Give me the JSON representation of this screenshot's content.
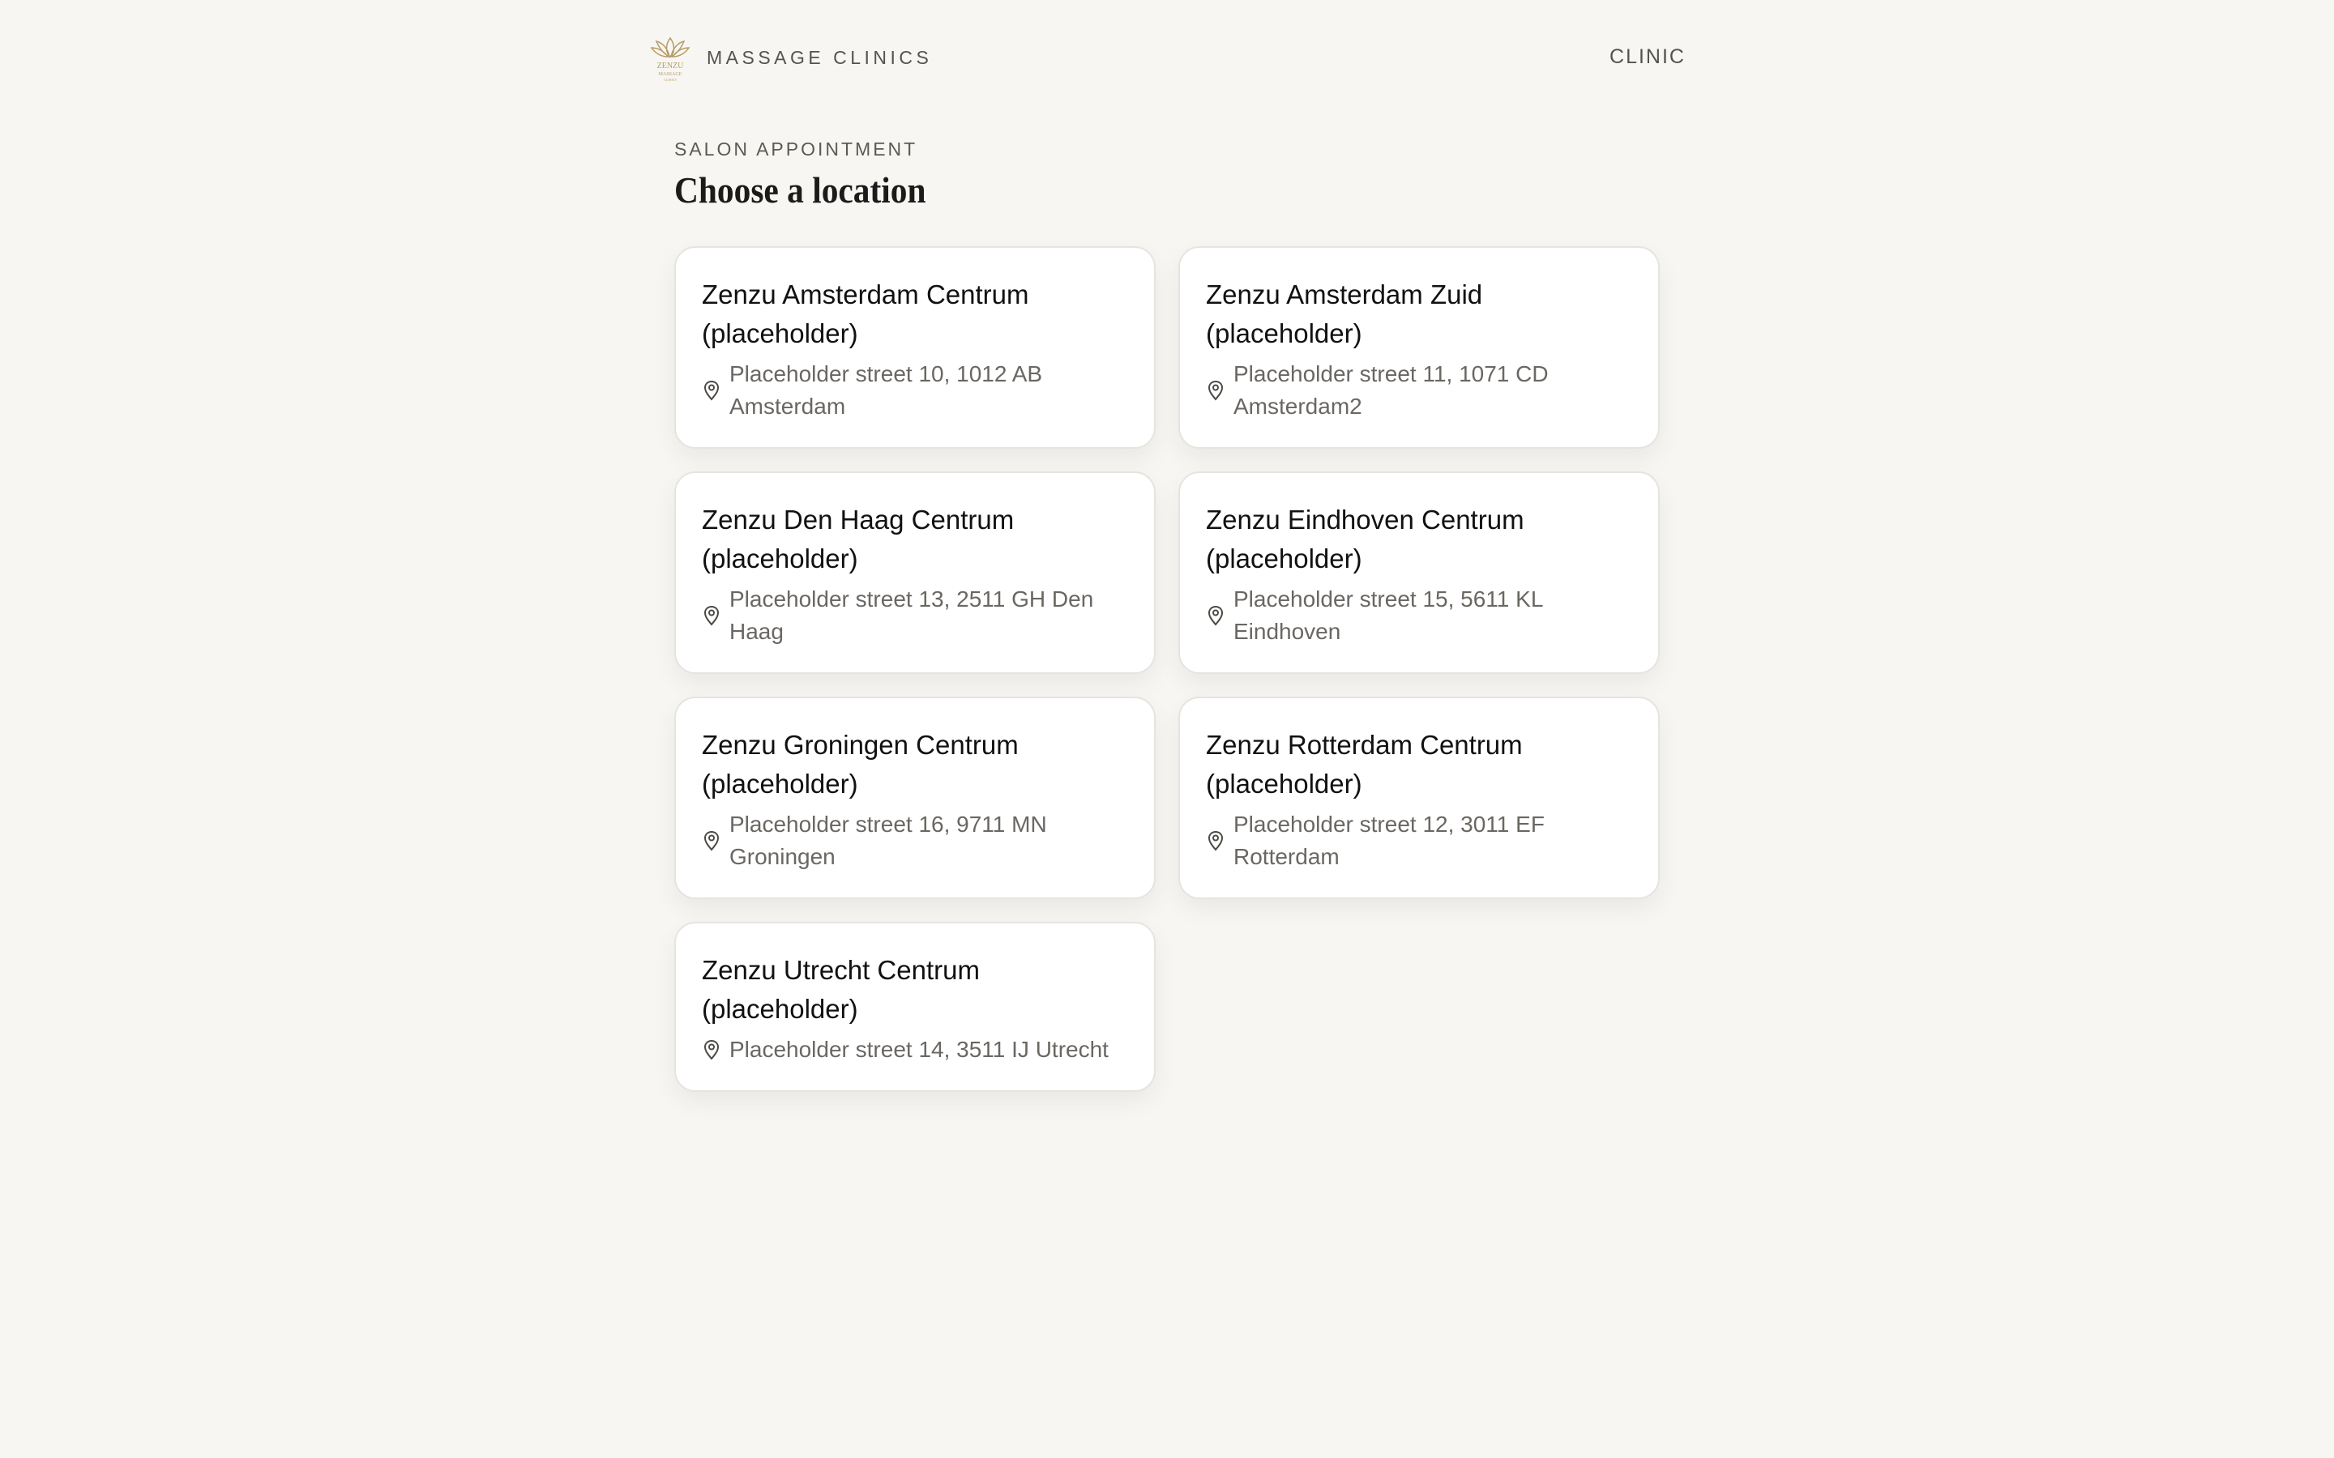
{
  "header": {
    "logo_icon": "lotus-logo-icon",
    "logo_lines": [
      "ZENZU",
      "MASSAGE",
      "CLINICS"
    ],
    "brand_text": "MASSAGE CLINICS",
    "nav_label": "CLINIC"
  },
  "page": {
    "eyebrow": "SALON APPOINTMENT",
    "title": "Choose a location"
  },
  "locations": [
    {
      "name": "Zenzu Amsterdam Centrum (placeholder)",
      "address": "Placeholder street 10, 1012 AB Amsterdam"
    },
    {
      "name": "Zenzu Amsterdam Zuid (placeholder)",
      "address": "Placeholder street 11, 1071 CD Amsterdam2"
    },
    {
      "name": "Zenzu Den Haag Centrum (placeholder)",
      "address": "Placeholder street 13, 2511 GH Den Haag"
    },
    {
      "name": "Zenzu Eindhoven Centrum (placeholder)",
      "address": "Placeholder street 15, 5611 KL Eindhoven"
    },
    {
      "name": "Zenzu Groningen Centrum (placeholder)",
      "address": "Placeholder street 16, 9711 MN Groningen"
    },
    {
      "name": "Zenzu Rotterdam Centrum (placeholder)",
      "address": "Placeholder street 12, 3011 EF Rotterdam"
    },
    {
      "name": "Zenzu Utrecht Centrum (placeholder)",
      "address": "Placeholder street 14, 3511 IJ Utrecht"
    }
  ],
  "icons": {
    "address": "location-pin-icon"
  },
  "colors": {
    "background": "#f8f6f2",
    "card_background": "#ffffff",
    "card_border": "#e6e4df",
    "logo_gold": "#b59c67",
    "muted_text": "#6a6763"
  }
}
